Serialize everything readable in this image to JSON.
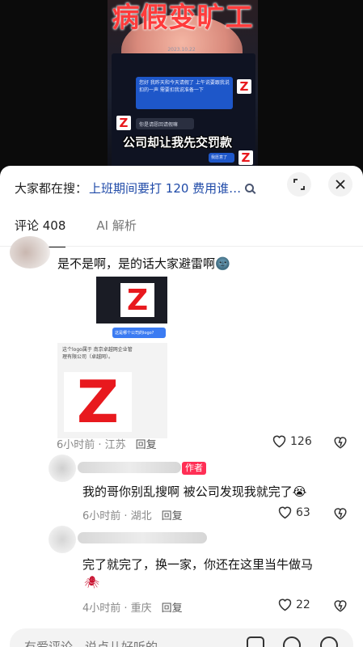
{
  "video": {
    "title_overlay": "病假变旷工",
    "chat_time": "2023.10.22",
    "msg1": "您好 我昨天和今天请假了 上午说要跟我说扣的一声 需要扣我说准备一下",
    "msg2": "你是请愿回请假嘛",
    "msg3": "我愿意了",
    "subtitle": "公司却让我先交罚款"
  },
  "header": {
    "search_prefix": "大家都在搜：",
    "search_query": "上班期间要打 120 费用谁…",
    "expand_icon": "expand-icon",
    "close_icon": "close-icon"
  },
  "tabs": [
    {
      "label": "评论 408",
      "active": true
    },
    {
      "label": "AI 解析",
      "active": false
    }
  ],
  "comments": [
    {
      "text": "是不是啊，是的话大家避雷啊",
      "emoji": "🌚",
      "image": {
        "chip": "这是哪个公司的logo?",
        "card_text": "这个logo属于 南京卓越网企业管理有限公司（卓越网）。"
      },
      "meta": "6小时前 · 江苏",
      "reply_label": "回复",
      "likes": "126"
    },
    {
      "author_tag": "作者",
      "text": "我的哥你别乱搜啊 被公司发现我就完了",
      "emoji": "😭",
      "meta": "6小时前 · 湖北",
      "reply_label": "回复",
      "likes": "63"
    },
    {
      "text": "完了就完了，换一家，你还在这里当牛做马",
      "emoji": "🕷",
      "meta": "4小时前 · 重庆",
      "reply_label": "回复",
      "likes": "22"
    }
  ],
  "input": {
    "placeholder": "有爱评论，说点儿好听的"
  },
  "colors": {
    "accent_pink": "#ff2f55",
    "link_blue": "#1f4aa8",
    "logo_red": "#e8191e"
  }
}
